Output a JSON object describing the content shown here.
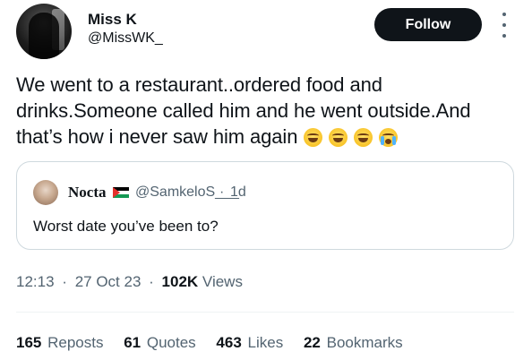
{
  "author": {
    "name": "Miss K",
    "handle": "@MissWK_"
  },
  "follow_label": "Follow",
  "tweet": {
    "text": "We went to a restaurant..ordered food and drinks.Someone called him and he went outside.And that’s how i never saw him again",
    "emojis": [
      "grinning-sweat-emoji",
      "grinning-sweat-emoji",
      "grinning-sweat-emoji",
      "crying-emoji"
    ]
  },
  "quoted": {
    "name": "Nocta",
    "flag": "palestine-flag-icon",
    "handle": "@SamkeloS___",
    "separator": "·",
    "time": "1d",
    "text": "Worst date you’ve been to?"
  },
  "meta": {
    "time": "12:13",
    "separator": "·",
    "date": "27 Oct 23",
    "views_count": "102K",
    "views_label": "Views"
  },
  "stats": [
    {
      "count": "165",
      "label": "Reposts"
    },
    {
      "count": "61",
      "label": "Quotes"
    },
    {
      "count": "463",
      "label": "Likes"
    },
    {
      "count": "22",
      "label": "Bookmarks"
    }
  ],
  "colors": {
    "text": "#0f1419",
    "secondary": "#536471",
    "border": "#cfd9de",
    "follow_bg": "#0f1419"
  }
}
